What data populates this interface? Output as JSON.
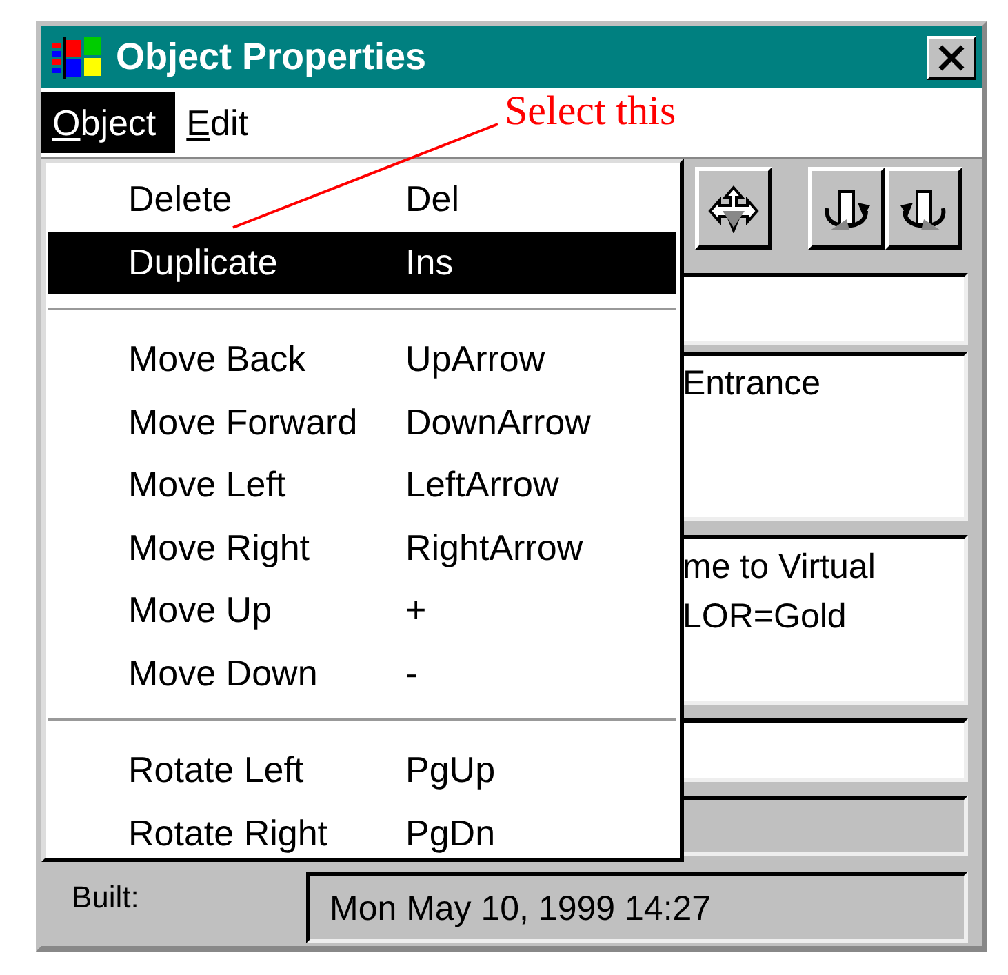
{
  "window": {
    "title": "Object Properties"
  },
  "menu_bar": [
    {
      "label": "Object",
      "selected": true
    },
    {
      "label": "Edit",
      "selected": false
    }
  ],
  "menu": [
    {
      "kind": "item",
      "label": "Delete",
      "shortcut": "Del",
      "selected": false
    },
    {
      "kind": "item",
      "label": "Duplicate",
      "shortcut": "Ins",
      "selected": true
    },
    {
      "kind": "separator"
    },
    {
      "kind": "item",
      "label": "Move Back",
      "shortcut": "UpArrow",
      "selected": false
    },
    {
      "kind": "item",
      "label": "Move Forward",
      "shortcut": "DownArrow",
      "selected": false
    },
    {
      "kind": "item",
      "label": "Move Left",
      "shortcut": "LeftArrow",
      "selected": false
    },
    {
      "kind": "item",
      "label": "Move Right",
      "shortcut": "RightArrow",
      "selected": false
    },
    {
      "kind": "item",
      "label": "Move Up",
      "shortcut": "+",
      "selected": false
    },
    {
      "kind": "item",
      "label": "Move Down",
      "shortcut": "-",
      "selected": false
    },
    {
      "kind": "separator"
    },
    {
      "kind": "item",
      "label": "Rotate Left",
      "shortcut": "PgUp",
      "selected": false
    },
    {
      "kind": "item",
      "label": "Rotate Right",
      "shortcut": "PgDn",
      "selected": false
    }
  ],
  "annotation": {
    "text": "Select this"
  },
  "toolbar": [
    {
      "kind": "move"
    },
    {
      "kind": "rotate-left"
    },
    {
      "kind": "rotate-right"
    }
  ],
  "fields": [
    {
      "kind": "line",
      "disabled": false
    },
    {
      "kind": "box",
      "disabled": false,
      "lines": [
        "Entrance"
      ]
    },
    {
      "kind": "box",
      "disabled": false,
      "lines": [
        "me to Virtual",
        "LOR=Gold"
      ]
    },
    {
      "kind": "line",
      "disabled": false
    },
    {
      "kind": "line",
      "disabled": true
    }
  ],
  "built": {
    "label": "Built:",
    "value": "Mon May 10, 1999 14:27"
  }
}
